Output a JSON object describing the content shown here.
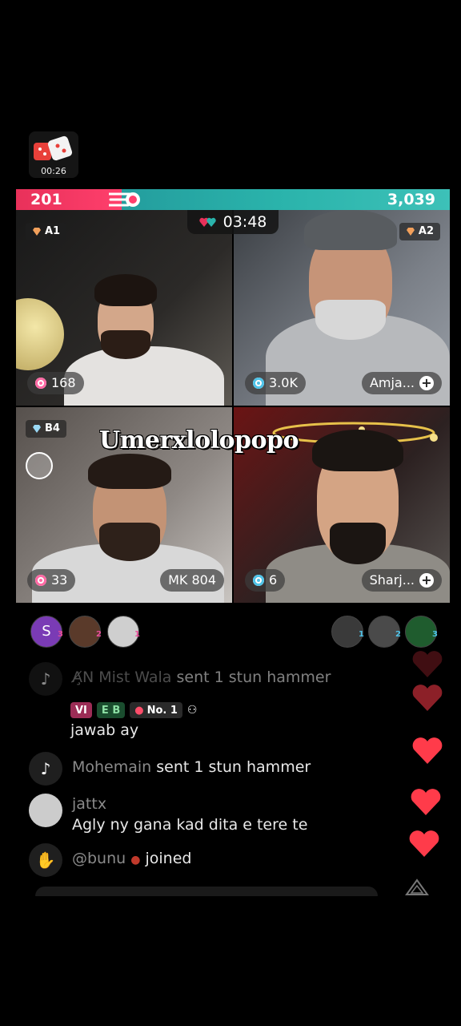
{
  "game": {
    "timer": "00:26"
  },
  "battle": {
    "left_score": "201",
    "right_score": "3,039",
    "timer": "03:48"
  },
  "tiles": [
    {
      "tag": "A1",
      "count": "168",
      "icon": "pink-gift-icon"
    },
    {
      "tag": "A2",
      "count": "3.0K",
      "name": "Amja...",
      "icon": "blue-gift-icon"
    },
    {
      "tag": "B4",
      "count": "33",
      "label": "MK 804",
      "icon": "pink-gift-icon"
    },
    {
      "count": "6",
      "name": "Sharj...",
      "icon": "blue-gift-icon"
    }
  ],
  "overlay": {
    "text": "Umerxlolopopo"
  },
  "viewers": {
    "left": [
      {
        "initial": "S",
        "rank": "3",
        "color": "#7a3bb5"
      },
      {
        "initial": "",
        "rank": "2",
        "color": "#5a3a2a"
      },
      {
        "initial": "",
        "rank": "1",
        "color": "#cfcfcf"
      }
    ],
    "right": [
      {
        "rank": "1",
        "color": "#3a3a3a"
      },
      {
        "rank": "2",
        "color": "#4a4a4a"
      },
      {
        "rank": "3",
        "color": "#1f5c2e"
      }
    ]
  },
  "chat": [
    {
      "user": "A̸̧N Mist Wala",
      "text": "sent 1 stun hammer"
    },
    {
      "badge_vi": "VI",
      "badge_eb": "E B",
      "no1": "No. 1",
      "text": "jawab ay"
    },
    {
      "user": "Mohemain",
      "text": "sent 1 stun hammer"
    },
    {
      "user": "jattx",
      "text": "Agly ny gana kad dita e tere te"
    },
    {
      "user": "@bunu",
      "text": "joined"
    }
  ],
  "colors": {
    "left_team": "#ff3f6c",
    "right_team": "#2ab3ab",
    "heart": "#ff3b4a"
  }
}
